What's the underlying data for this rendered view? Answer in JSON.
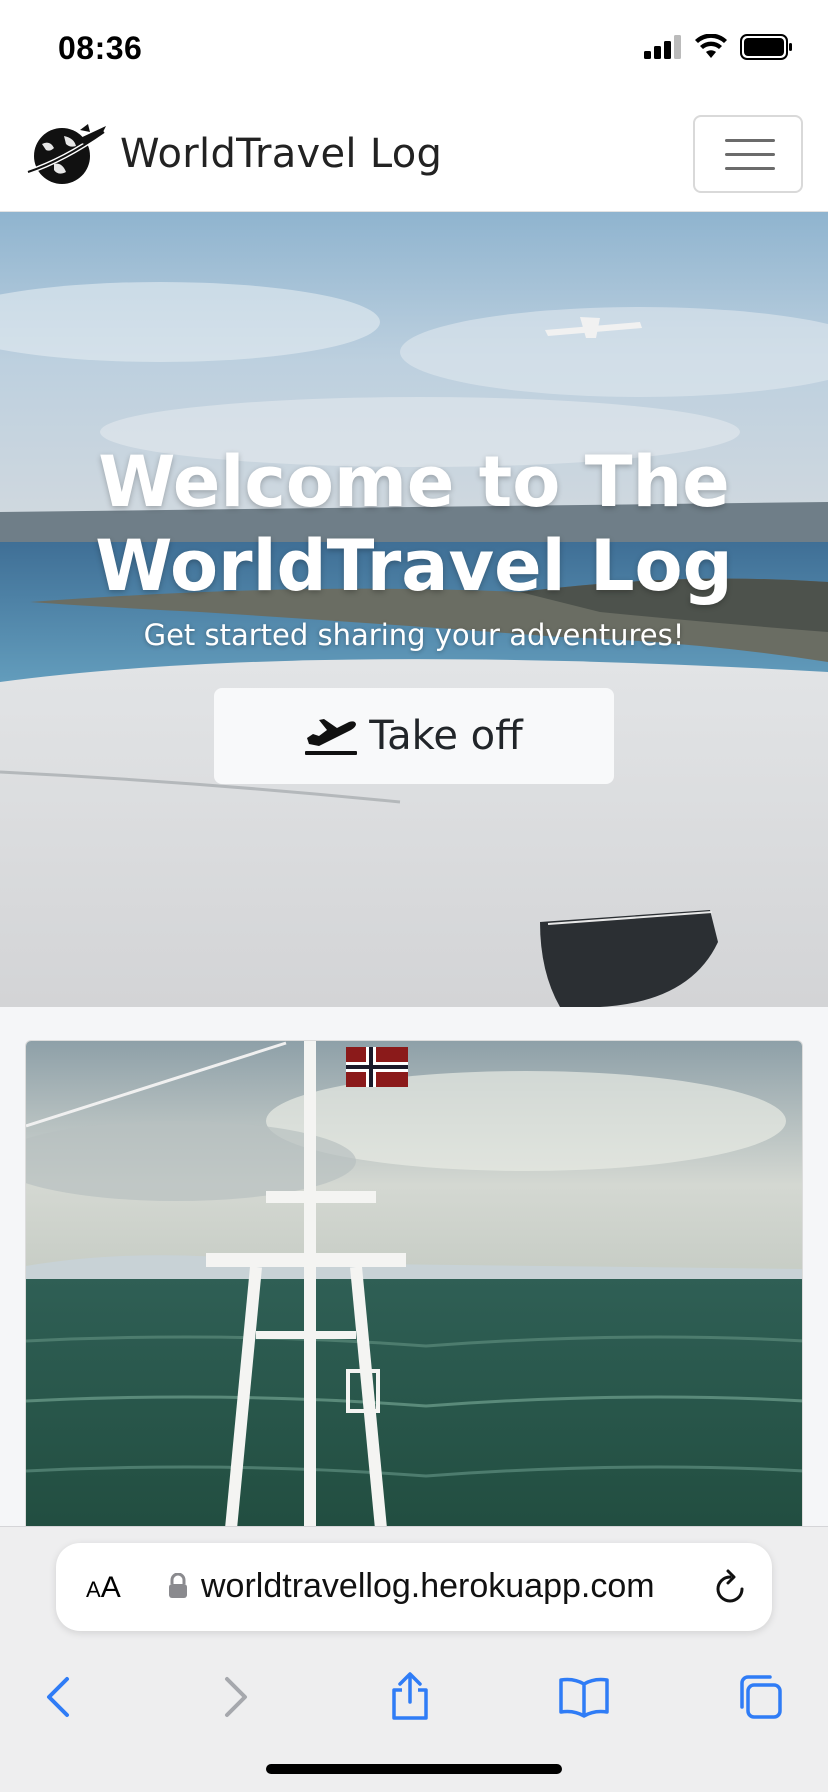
{
  "status": {
    "time": "08:36"
  },
  "navbar": {
    "brand": "WorldTravel Log"
  },
  "hero": {
    "title_line1": "Welcome to The",
    "title_line2": "WorldTravel Log",
    "subtitle": "Get started sharing your adventures!",
    "button_label": "Take off"
  },
  "safari": {
    "text_size_small": "A",
    "text_size_large": "A",
    "url": "worldtravellog.herokuapp.com"
  },
  "icons": {
    "brand": "globe-plane-icon",
    "menu": "hamburger-icon",
    "takeoff": "plane-departure-icon",
    "lock": "lock-icon",
    "reload": "reload-icon",
    "back": "chevron-left-icon",
    "forward": "chevron-right-icon",
    "share": "share-icon",
    "bookmarks": "book-icon",
    "tabs": "tabs-icon"
  },
  "colors": {
    "accent": "#2f7cf6",
    "hero_button": "#f8f9fa"
  }
}
